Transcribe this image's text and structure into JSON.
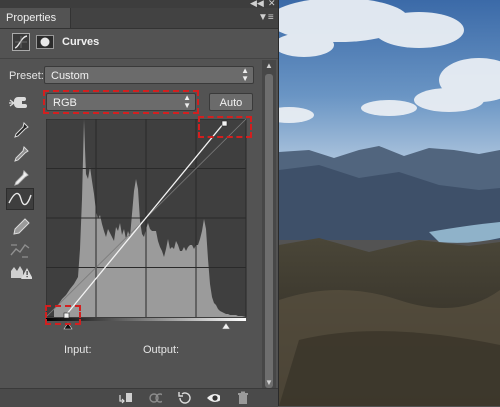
{
  "panel": {
    "tab_label": "Properties",
    "title": "Curves",
    "preset_label": "Preset:",
    "preset_value": "Custom",
    "channel_value": "RGB",
    "auto_label": "Auto",
    "input_label": "Input:",
    "output_label": "Output:"
  },
  "icons": {
    "collapse": "double-chevron-left-icon",
    "close": "close-icon",
    "menu": "panel-menu-icon",
    "adjustment": "curves-adjustment-icon",
    "mask": "layer-mask-icon",
    "target": "on-image-adjust-icon",
    "black_eyedropper": "sample-black-eyedropper-icon",
    "gray_eyedropper": "sample-gray-eyedropper-icon",
    "white_eyedropper": "sample-white-eyedropper-icon",
    "curve_tool": "edit-points-curve-icon",
    "pencil_tool": "draw-pencil-icon",
    "smooth_tool": "smooth-curve-icon",
    "clipping_warning": "clipping-warning-icon",
    "clip_to_layer": "clip-to-layer-icon",
    "view_previous": "view-previous-state-icon",
    "reset": "reset-icon",
    "visibility": "visibility-eye-icon",
    "delete": "trash-icon"
  },
  "colors": {
    "panel_bg": "#535353",
    "highlight": "#d21f1f"
  }
}
